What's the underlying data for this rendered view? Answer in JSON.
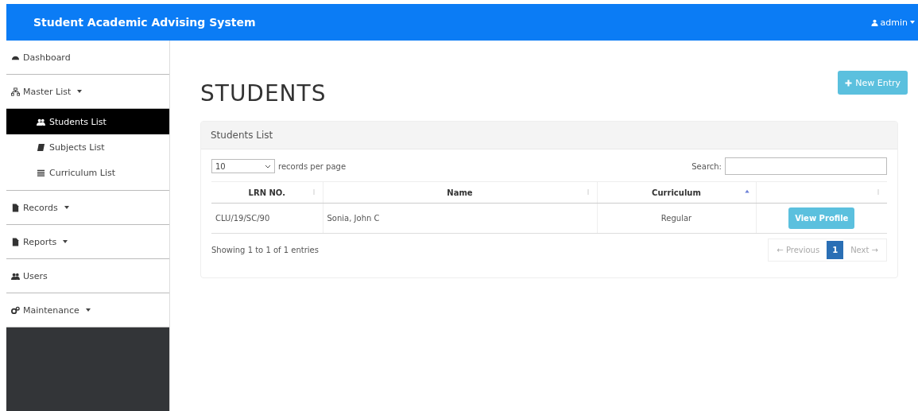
{
  "navbar": {
    "brand": "Student Academic Advising System",
    "user": "admin"
  },
  "sidebar": {
    "items": [
      {
        "label": "Dashboard",
        "dropdown": false,
        "selected": false
      },
      {
        "label": "Master List",
        "dropdown": true,
        "selected": false,
        "children": [
          {
            "label": "Students List",
            "selected": true
          },
          {
            "label": "Subjects List",
            "selected": false
          },
          {
            "label": "Curriculum List",
            "selected": false
          }
        ]
      },
      {
        "label": "Records",
        "dropdown": true,
        "selected": false
      },
      {
        "label": "Reports",
        "dropdown": true,
        "selected": false
      },
      {
        "label": "Users",
        "dropdown": false,
        "selected": false
      },
      {
        "label": "Maintenance",
        "dropdown": true,
        "selected": false
      }
    ]
  },
  "page": {
    "title": "STUDENTS",
    "new_button": "New Entry"
  },
  "panel": {
    "heading": "Students List",
    "page_size": "10",
    "page_size_label": "records per page",
    "search_label": "Search:",
    "columns": [
      {
        "label": "LRN NO.",
        "sorted": false
      },
      {
        "label": "Name",
        "sorted": false
      },
      {
        "label": "Curriculum",
        "sorted": true
      },
      {
        "sorted": false
      }
    ],
    "rows": [
      {
        "lrn": "CLU/19/SC/90",
        "name": "Sonia, John C",
        "curriculum": "Regular",
        "action": "View Profile"
      }
    ],
    "info": "Showing 1 to 1 of 1 entries",
    "pagination": [
      {
        "label": "← Previous",
        "selected": false,
        "disabled": true
      },
      {
        "label": "1",
        "selected": true,
        "disabled": false
      },
      {
        "label": "Next →",
        "selected": false,
        "disabled": true
      }
    ]
  }
}
